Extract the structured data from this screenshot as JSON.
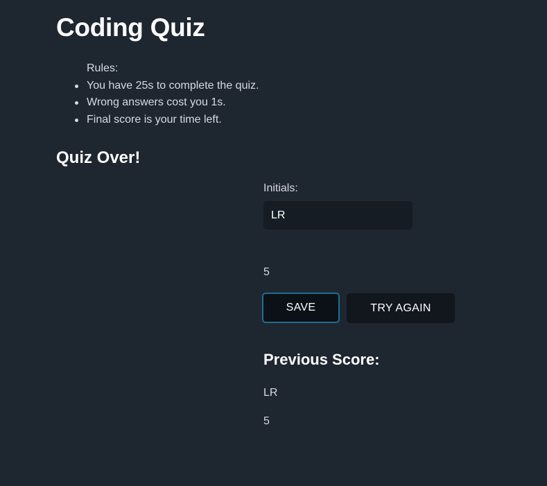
{
  "page": {
    "title": "Coding Quiz"
  },
  "rules": {
    "heading": "Rules:",
    "items": [
      "You have 25s to complete the quiz.",
      "Wrong answers cost you 1s.",
      "Final score is your time left."
    ]
  },
  "result": {
    "heading": "Quiz Over!",
    "initials_label": "Initials:",
    "initials_value": "LR",
    "score": "5"
  },
  "buttons": {
    "save_label": "SAVE",
    "try_again_label": "TRY AGAIN"
  },
  "previous": {
    "heading": "Previous Score:",
    "initials": "LR",
    "score": "5"
  },
  "colors": {
    "background": "#1e2630",
    "input_background": "#161c23",
    "button_background": "#12171d",
    "focus_border": "#1f6e91"
  }
}
